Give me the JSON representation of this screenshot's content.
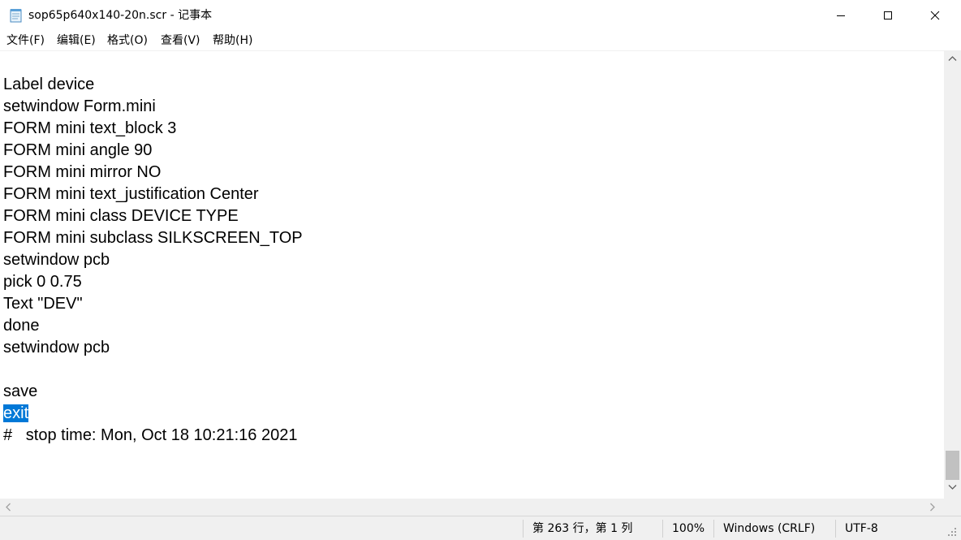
{
  "window": {
    "title": "sop65p640x140-20n.scr - 记事本",
    "icon": "notepad-icon"
  },
  "menu": {
    "items": [
      {
        "label": "文件(F)"
      },
      {
        "label": "编辑(E)"
      },
      {
        "label": "格式(O)"
      },
      {
        "label": "查看(V)"
      },
      {
        "label": "帮助(H)"
      }
    ]
  },
  "editor": {
    "lines": [
      "Label device",
      "setwindow Form.mini",
      "FORM mini text_block 3",
      "FORM mini angle 90",
      "FORM mini mirror NO",
      "FORM mini text_justification Center",
      "FORM mini class DEVICE TYPE",
      "FORM mini subclass SILKSCREEN_TOP",
      "setwindow pcb",
      "pick 0 0.75",
      "Text \"DEV\"",
      "done",
      "setwindow pcb",
      "",
      "save",
      "exit",
      "#   stop time: Mon, Oct 18 10:21:16 2021"
    ],
    "selected_text": "exit"
  },
  "status": {
    "position": "第 263 行，第 1 列",
    "zoom": "100%",
    "line_ending": "Windows (CRLF)",
    "encoding": "UTF-8"
  },
  "colors": {
    "selection": "#0078d7",
    "chrome": "#f0f0f0"
  }
}
